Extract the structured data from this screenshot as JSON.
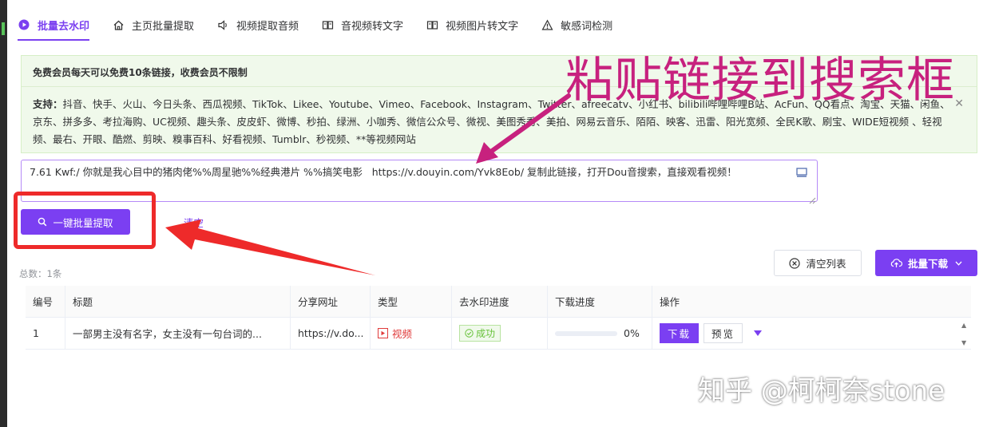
{
  "tabs": [
    {
      "label": "批量去水印",
      "icon": "play-circle-icon"
    },
    {
      "label": "主页批量提取",
      "icon": "home-icon"
    },
    {
      "label": "视频提取音频",
      "icon": "speaker-icon"
    },
    {
      "label": "音视频转文字",
      "icon": "book-icon"
    },
    {
      "label": "视频图片转文字",
      "icon": "book-icon"
    },
    {
      "label": "敏感词检测",
      "icon": "warning-icon"
    }
  ],
  "notice": {
    "title": "免费会员每天可以免费10条链接，收费会员不限制",
    "support_label": "支持：",
    "support_text": "抖音、快手、火山、今日头条、西瓜视频、TikTok、Likee、Youtube、Vimeo、Facebook、Instagram、Twitter、afreecatv、小红书、bilibili哔哩哔哩B站、AcFun、QQ看点、淘宝、天猫、闲鱼、京东、拼多多、考拉海购、UC视频、趣头条、皮皮虾、微博、秒拍、绿洲、小咖秀、微信公众号、微视、美图秀秀、美拍、网易云音乐、陌陌、映客、迅雷、阳光宽频、全民K歌、刷宝、WIDE短视频 、轻视频、最右、开眼、酷燃、剪映、糗事百科、好看视频、Tumblr、秒视频、**等视频网站"
  },
  "input": {
    "value": "7.61 Kwf:/ 你就是我心目中的猪肉佬%%周星驰%%经典港片 %%搞笑电影   https://v.douyin.com/Yvk8Eob/ 复制此链接，打开Dou音搜索，直接观看视频！"
  },
  "actions": {
    "extract_label": "一键批量提取",
    "clear_label": "清空",
    "clear_list_label": "清空列表",
    "batch_download_label": "批量下载"
  },
  "total_text": "总数：1条",
  "table": {
    "headers": [
      "编号",
      "标题",
      "分享网址",
      "类型",
      "去水印进度",
      "下载进度",
      "操作"
    ],
    "rows": [
      {
        "id": "1",
        "title": "一部男主没有名字，女主没有一句台词的...",
        "url": "https://v.do...",
        "type": "视频",
        "watermark_status": "成功",
        "download_progress": "0%",
        "download_fraction": 0,
        "download_label": "下载",
        "preview_label": "预览"
      }
    ]
  },
  "annotations": {
    "paste_hint": "粘贴链接到搜索框",
    "watermark": "知乎 @柯柯奈stone"
  },
  "colors": {
    "accent": "#7b3ff2",
    "annotation_magenta": "#c7217e",
    "annotation_red": "#ee2a2a",
    "success": "#67c23a",
    "notice_bg": "#f0f9eb"
  }
}
